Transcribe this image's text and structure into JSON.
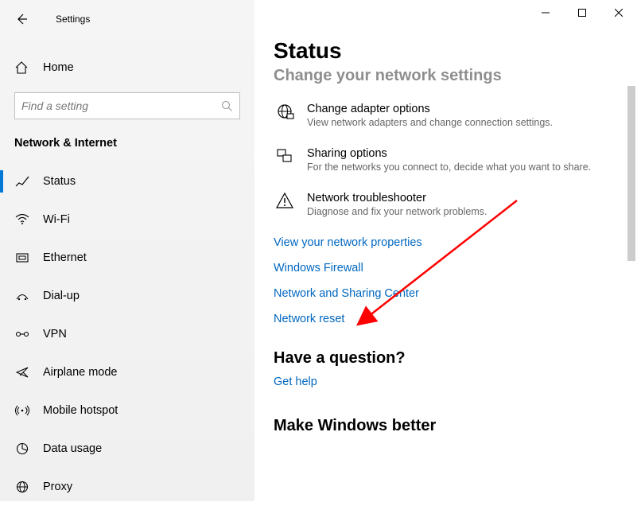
{
  "window": {
    "title": "Settings"
  },
  "sidebar": {
    "home_label": "Home",
    "search_placeholder": "Find a setting",
    "category": "Network & Internet",
    "items": [
      {
        "label": "Status",
        "icon": "status-icon",
        "selected": true
      },
      {
        "label": "Wi-Fi",
        "icon": "wifi-icon"
      },
      {
        "label": "Ethernet",
        "icon": "ethernet-icon"
      },
      {
        "label": "Dial-up",
        "icon": "dialup-icon"
      },
      {
        "label": "VPN",
        "icon": "vpn-icon"
      },
      {
        "label": "Airplane mode",
        "icon": "airplane-icon"
      },
      {
        "label": "Mobile hotspot",
        "icon": "hotspot-icon"
      },
      {
        "label": "Data usage",
        "icon": "data-icon"
      },
      {
        "label": "Proxy",
        "icon": "proxy-icon"
      }
    ]
  },
  "main": {
    "title": "Status",
    "change_heading": "Change your network settings",
    "options": [
      {
        "title": "Change adapter options",
        "desc": "View network adapters and change connection settings.",
        "icon": "adapter-icon"
      },
      {
        "title": "Sharing options",
        "desc": "For the networks you connect to, decide what you want to share.",
        "icon": "sharing-icon"
      },
      {
        "title": "Network troubleshooter",
        "desc": "Diagnose and fix your network problems.",
        "icon": "troubleshoot-icon"
      }
    ],
    "links": [
      "View your network properties",
      "Windows Firewall",
      "Network and Sharing Center",
      "Network reset"
    ],
    "question_heading": "Have a question?",
    "help_link": "Get help",
    "feedback_heading": "Make Windows better"
  }
}
